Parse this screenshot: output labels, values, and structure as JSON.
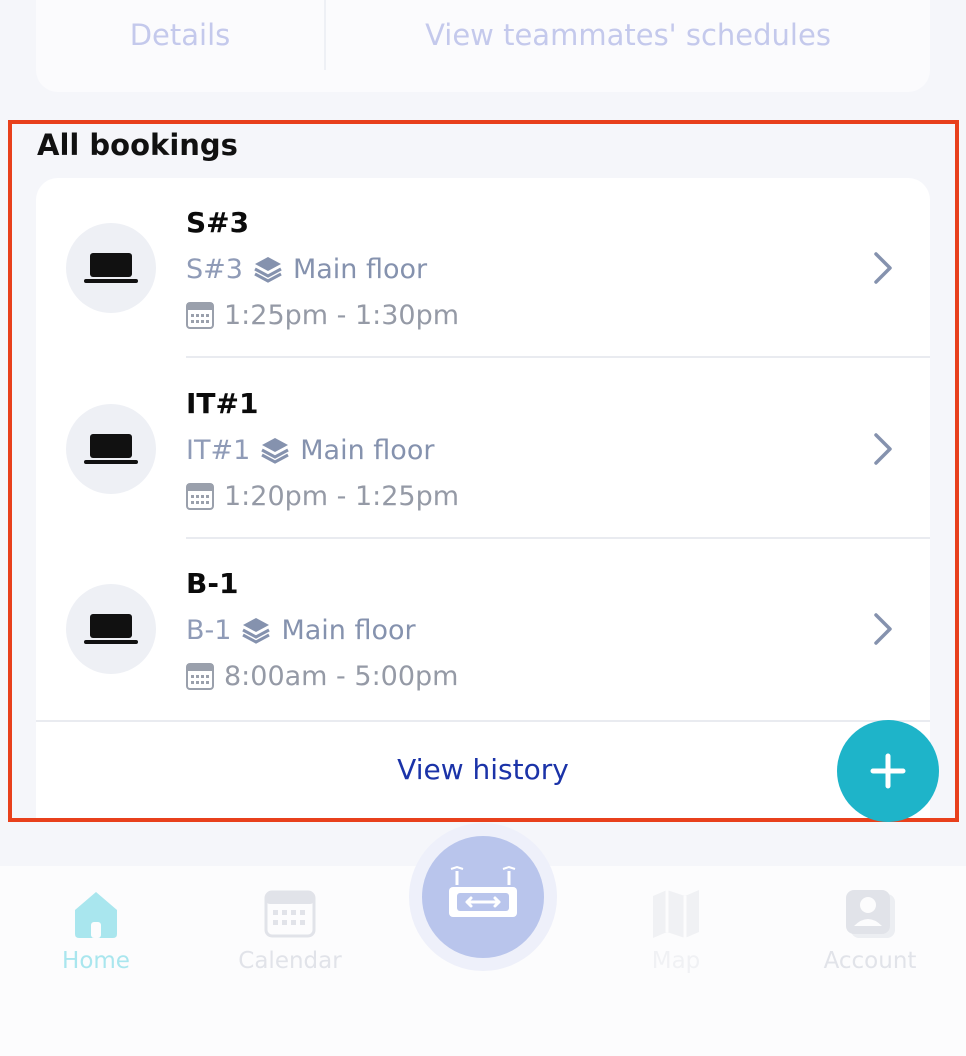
{
  "top_tabs": {
    "details_label": "Details",
    "teammates_label": "View teammates' schedules"
  },
  "section_title": "All bookings",
  "bookings": [
    {
      "title": "S#3",
      "desk": "S#3",
      "floor": "Main floor",
      "time": "1:25pm - 1:30pm"
    },
    {
      "title": "IT#1",
      "desk": "IT#1",
      "floor": "Main floor",
      "time": "1:20pm - 1:25pm"
    },
    {
      "title": "B-1",
      "desk": "B-1",
      "floor": "Main floor",
      "time": "8:00am - 5:00pm"
    }
  ],
  "view_history_label": "View history",
  "fab_icon": "plus-icon",
  "bottom_nav": {
    "home": "Home",
    "calendar": "Calendar",
    "map": "Map",
    "account": "Account"
  },
  "colors": {
    "accent": "#1eb4c9",
    "link": "#1b33a8",
    "highlight_frame": "#e8401c"
  }
}
